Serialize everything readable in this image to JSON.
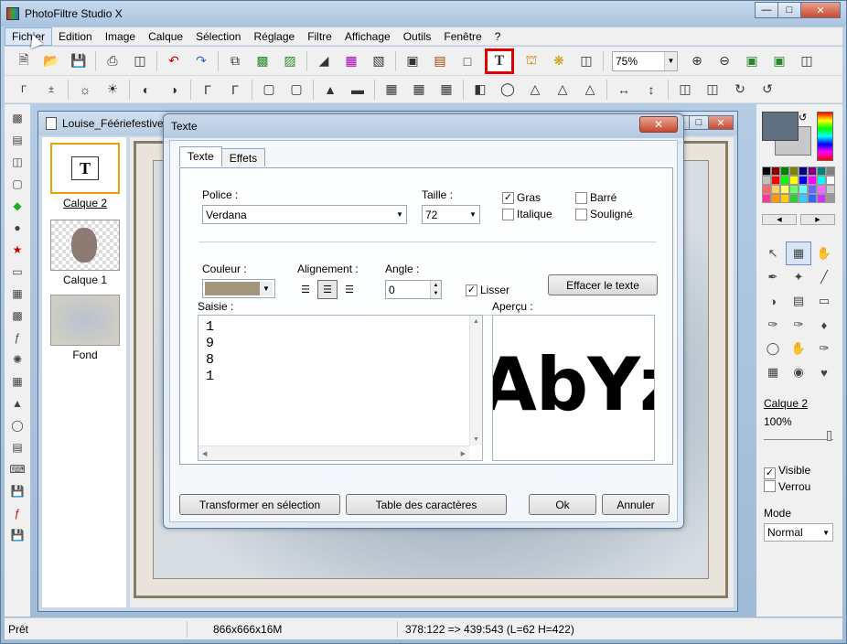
{
  "app": {
    "title": "PhotoFiltre Studio X"
  },
  "menu": [
    "Fichier",
    "Edition",
    "Image",
    "Calque",
    "Sélection",
    "Réglage",
    "Filtre",
    "Affichage",
    "Outils",
    "Fenêtre",
    "?"
  ],
  "toolbar": {
    "zoom": "75%",
    "text_tool_glyph": "T"
  },
  "document": {
    "title": "Louise_Fééri​efestive_",
    "layers": [
      {
        "name": "Calque 2",
        "selected": true
      },
      {
        "name": "Calque 1",
        "selected": false
      },
      {
        "name": "Fond",
        "selected": false
      }
    ]
  },
  "right_panel": {
    "layer_name": "Calque 2",
    "opacity": "100%",
    "visible_label": "Visible",
    "visible_checked": true,
    "lock_label": "Verrou",
    "lock_checked": false,
    "mode_label": "Mode",
    "mode_value": "Normal",
    "fg_color": "#617080",
    "bg_color": "#c8c8c8"
  },
  "status": {
    "state": "Prêt",
    "size": "866x666x16M",
    "coords": "378:122 => 439:543 (L=62  H=422)"
  },
  "dialog": {
    "title": "Texte",
    "tabs": [
      "Texte",
      "Effets"
    ],
    "police_label": "Police :",
    "police_value": "Verdana",
    "taille_label": "Taille :",
    "taille_value": "72",
    "gras_label": "Gras",
    "gras_checked": true,
    "italique_label": "Italique",
    "italique_checked": false,
    "barre_label": "Barré",
    "barre_checked": false,
    "souligne_label": "Souligné",
    "souligne_checked": false,
    "couleur_label": "Couleur :",
    "couleur_value": "#a1967d",
    "alignement_label": "Alignement :",
    "angle_label": "Angle :",
    "angle_value": "0",
    "lisser_label": "Lisser",
    "lisser_checked": true,
    "effacer_button": "Effacer le texte",
    "saisie_label": "Saisie :",
    "saisie_text": "1\n9\n8\n1",
    "apercu_label": "Aperçu :",
    "apercu_text": "AbYz",
    "transformer_button": "Transformer en sélection",
    "table_button": "Table des caractères",
    "ok_button": "Ok",
    "annuler_button": "Annuler"
  }
}
